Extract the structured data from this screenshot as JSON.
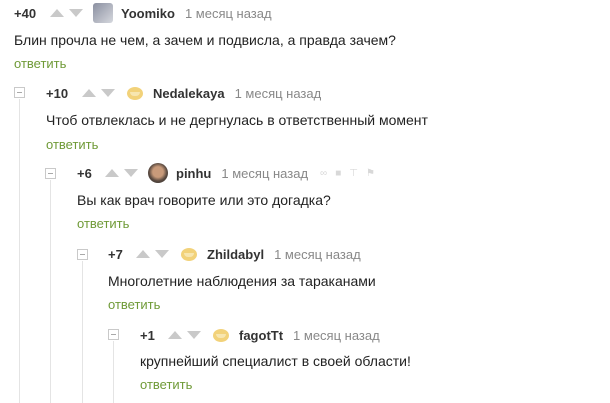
{
  "comments": [
    {
      "rating": "+40",
      "author": "Yoomiko",
      "time": "1 месяц назад",
      "text": "Блин прочла не чем, а зачем и подвисла, а правда зачем?",
      "reply": "ответить",
      "avatar": "photo-avatar"
    },
    {
      "rating": "+10",
      "author": "Nedalekaya",
      "time": "1 месяц назад",
      "text": "Чтоб отвлеклась и не дергнулась в ответственный момент",
      "reply": "ответить",
      "avatar": "default-avatar"
    },
    {
      "rating": "+6",
      "author": "pinhu",
      "time": "1 месяц назад",
      "text": "Вы как врач говорите или это догадка?",
      "reply": "ответить",
      "avatar": "photo-avatar"
    },
    {
      "rating": "+7",
      "author": "Zhildabyl",
      "time": "1 месяц назад",
      "text": "Многолетние наблюдения за тараканами",
      "reply": "ответить",
      "avatar": "default-avatar"
    },
    {
      "rating": "+1",
      "author": "fagotTt",
      "time": "1 месяц назад",
      "text": "крупнейший специалист в своей области!",
      "reply": "ответить",
      "avatar": "default-avatar"
    }
  ],
  "colors": {
    "reply": "#6f9a37",
    "arrow": "#c9c9c9",
    "thread_line": "#e4e4e4"
  }
}
